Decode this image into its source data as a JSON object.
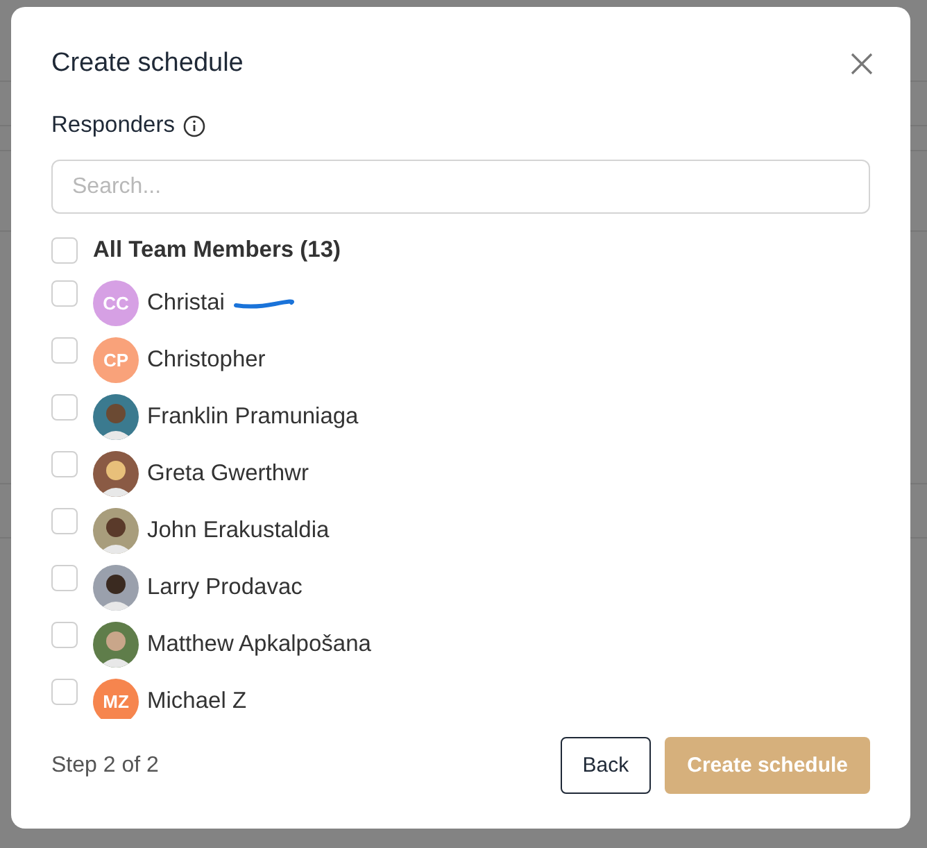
{
  "dialog": {
    "title": "Create schedule",
    "section_label": "Responders",
    "search": {
      "placeholder": "Search..."
    },
    "select_all": {
      "label": "All Team Members (13)",
      "checked": false
    },
    "members": [
      {
        "name": "Christai",
        "kind": "initials",
        "initials": "CC",
        "color": "#d6a0e4",
        "checked": false,
        "redacted": true
      },
      {
        "name": "Christopher",
        "kind": "initials",
        "initials": "CP",
        "color": "#f9a27a",
        "checked": false,
        "redacted": false
      },
      {
        "name": "Franklin Pramuniaga",
        "checked": false,
        "redacted": false
      },
      {
        "name": "Greta Gwerthwr",
        "checked": false,
        "redacted": false
      },
      {
        "name": "John Erakustaldia",
        "checked": false,
        "redacted": false
      },
      {
        "name": "Larry Prodavac",
        "checked": false,
        "redacted": false
      },
      {
        "name": "Matthew Apkalpošana",
        "checked": false,
        "redacted": false
      },
      {
        "name": "Michael Z",
        "kind": "initials",
        "initials": "MZ",
        "color": "#f6854e",
        "checked": false,
        "redacted": false
      }
    ],
    "step": "Step 2 of 2",
    "back_button": "Back",
    "create_button": {
      "label": "Create schedule",
      "disabled": true
    }
  }
}
